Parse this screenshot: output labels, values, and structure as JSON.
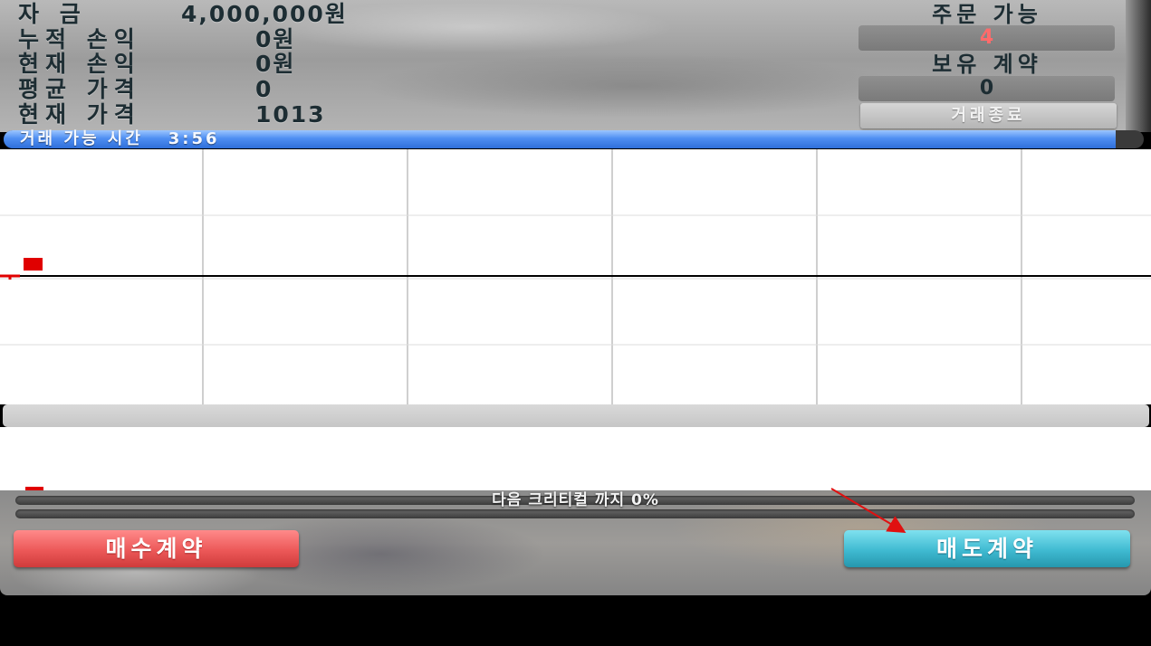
{
  "status": {
    "capital": {
      "label": "자    금",
      "value": "4,000,000원"
    },
    "cumulative_pnl": {
      "label": "누적 손익",
      "value": "0원"
    },
    "current_pnl": {
      "label": "현재 손익",
      "value": "0원"
    },
    "average_price": {
      "label": "평균 가격",
      "value": "0"
    },
    "current_price": {
      "label": "현재 가격",
      "value": "1013"
    }
  },
  "orders_available": {
    "label": "주문 가능",
    "value": "4",
    "color": "#ff6b6b"
  },
  "contracts_held": {
    "label": "보유 계약",
    "value": "0",
    "color": "#1d2d33"
  },
  "end_trade_label": "거래종료",
  "time_bar": {
    "label": "거래 가능 시간",
    "time": "3:56",
    "progress": 0.99
  },
  "chart_data": {
    "type": "line",
    "title": "",
    "xlabel": "",
    "ylabel": "",
    "grid": true,
    "baseline_price": 1013,
    "series": [
      {
        "x": [
          0,
          1
        ],
        "y": [
          1013,
          1013
        ],
        "color": "#e00000"
      }
    ],
    "marker_color": "#e00000",
    "baseline_color": "#000000"
  },
  "critical": {
    "label": "다음 크리티컬 까지 0%",
    "progress": 0
  },
  "buttons": {
    "buy_label": "매수계약",
    "sell_label": "매도계약",
    "buy_color": "#ec5858",
    "sell_color": "#3fbad1"
  }
}
